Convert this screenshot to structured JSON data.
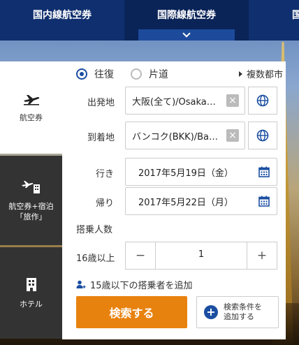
{
  "tabs": {
    "domestic": "国内線航空券",
    "international": "国際線航空券",
    "third_partial": "国"
  },
  "sidebar": {
    "items": [
      {
        "label": "航空券",
        "icon": "airplane-icon"
      },
      {
        "label": "航空券+宿泊「旅作」",
        "line1": "航空券+宿泊",
        "line2": "「旅作」",
        "icon": "plane-hotel-icon"
      },
      {
        "label": "ホテル",
        "icon": "hotel-icon"
      }
    ]
  },
  "trip_type": {
    "round_trip": "往復",
    "one_way": "片道",
    "multi_city": "複数都市",
    "selected": "round_trip"
  },
  "origin": {
    "label": "出発地",
    "value": "大阪(全て)/Osaka…"
  },
  "destination": {
    "label": "到着地",
    "value": "バンコク(BKK)/Ba…"
  },
  "outbound": {
    "label": "行き",
    "value": "2017年5月19日（金）"
  },
  "return": {
    "label": "帰り",
    "value": "2017年5月22日（月）"
  },
  "passengers": {
    "heading": "搭乗人数",
    "adult_label": "16歳以上",
    "adult_count": "1",
    "minus": "−",
    "plus": "+",
    "add_child": "15歳以下の搭乗者を追加"
  },
  "actions": {
    "search": "検索する",
    "add_conditions_line1": "検索条件を",
    "add_conditions_line2": "追加する"
  },
  "colors": {
    "navy": "#0f2f6e",
    "accent_blue": "#1a4ea1",
    "orange": "#e8820f",
    "sidebar_dark": "#333333"
  }
}
